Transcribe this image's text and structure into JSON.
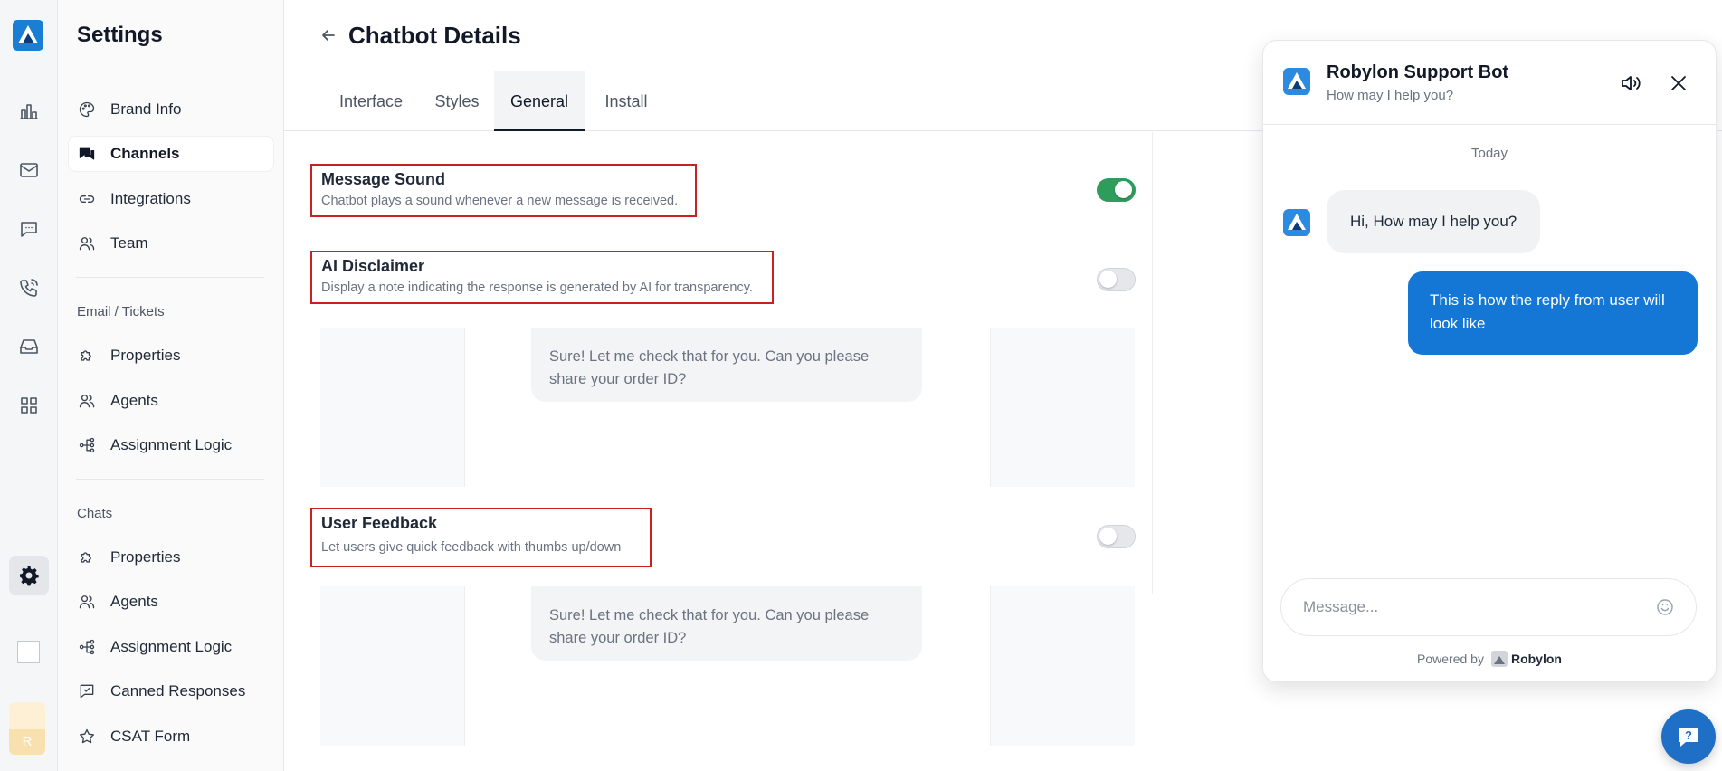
{
  "sidebar": {
    "title": "Settings",
    "items": [
      {
        "label": "Brand Info"
      },
      {
        "label": "Channels"
      },
      {
        "label": "Integrations"
      },
      {
        "label": "Team"
      }
    ],
    "email_section": "Email / Tickets",
    "email_items": [
      {
        "label": "Properties"
      },
      {
        "label": "Agents"
      },
      {
        "label": "Assignment Logic"
      }
    ],
    "chats_section": "Chats",
    "chats_items": [
      {
        "label": "Properties"
      },
      {
        "label": "Agents"
      },
      {
        "label": "Assignment Logic"
      },
      {
        "label": "Canned Responses"
      },
      {
        "label": "CSAT Form"
      }
    ]
  },
  "rail": {
    "avatar_initial": "R"
  },
  "header": {
    "title": "Chatbot Details"
  },
  "tabs": [
    {
      "label": "Interface"
    },
    {
      "label": "Styles"
    },
    {
      "label": "General"
    },
    {
      "label": "Install"
    }
  ],
  "settings": {
    "message_sound": {
      "title": "Message Sound",
      "desc": "Chatbot plays a sound whenever a new message is received.",
      "enabled": true
    },
    "ai_disclaimer": {
      "title": "AI Disclaimer",
      "desc": "Display a note indicating the response is generated by AI for transparency.",
      "enabled": false
    },
    "user_feedback": {
      "title": "User Feedback",
      "desc": "Let users give quick feedback with thumbs up/down",
      "enabled": false
    }
  },
  "preview": {
    "message": "Sure! Let me check that for you. Can you please share your order ID?"
  },
  "widget": {
    "title": "Robylon Support Bot",
    "subtitle": "How may I help you?",
    "date": "Today",
    "bot_message": "Hi, How may I help you?",
    "user_message": "This is how the reply from user will look like",
    "input_placeholder": "Message...",
    "powered_by": "Powered by",
    "brand": "Robylon"
  },
  "colors": {
    "toggle_on": "#2e9d5c",
    "user_bubble": "#1477d6",
    "highlight_border": "#cc1f1f",
    "fab": "#1f6fc7"
  }
}
